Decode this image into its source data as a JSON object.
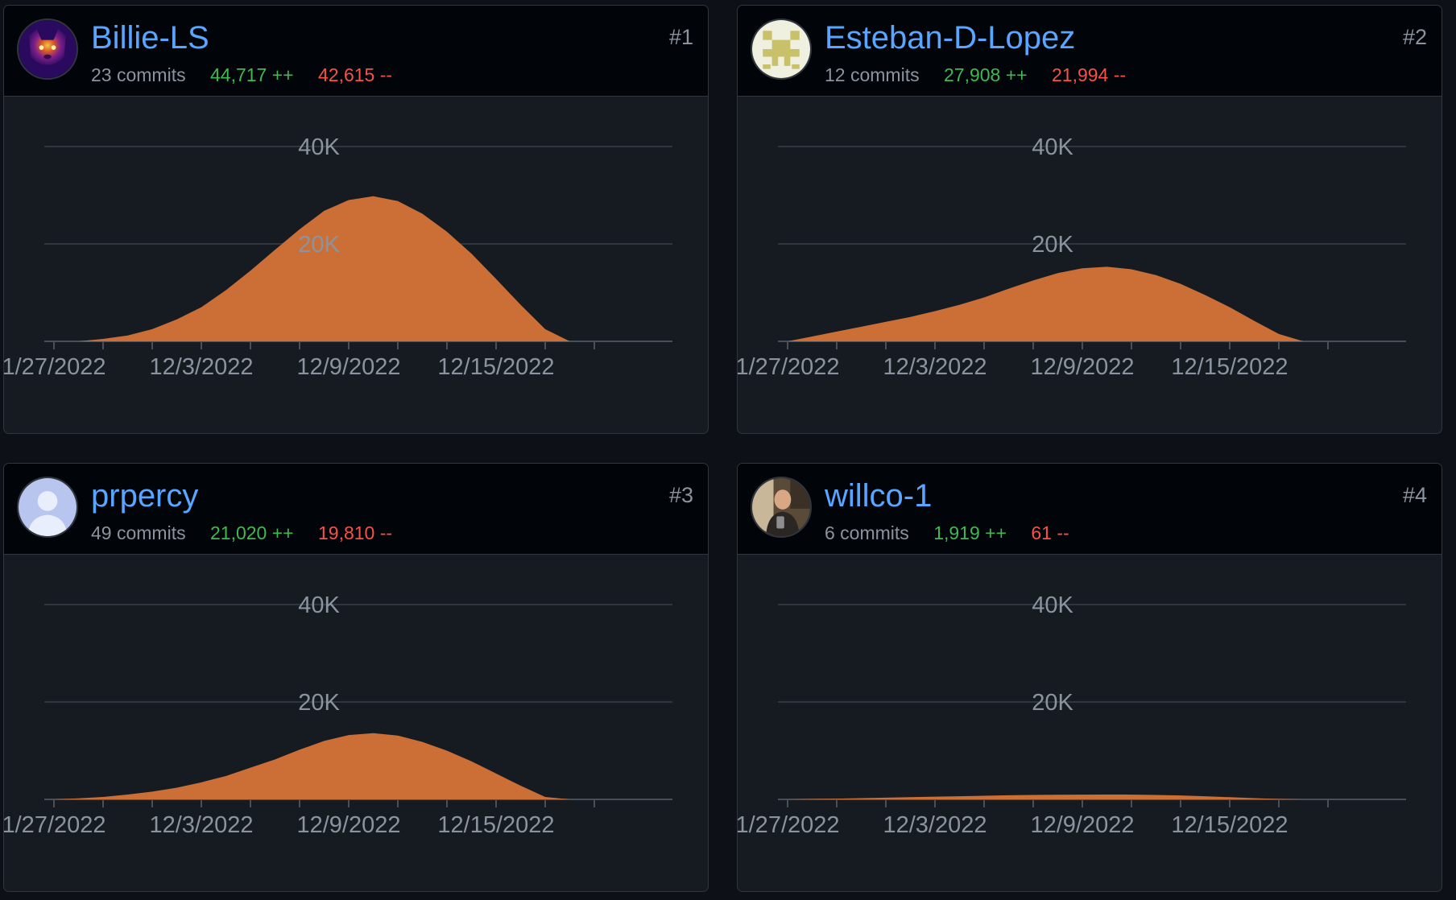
{
  "colors": {
    "area": "#cc6f37",
    "grid": "#30363d",
    "axis": "#484f58",
    "label": "#8b949e"
  },
  "cards": [
    {
      "rank": "#1",
      "username": "Billie-LS",
      "commits": "23 commits",
      "additions": "44,717 ++",
      "deletions": "42,615 --",
      "avatar": "dog-thermal-icon"
    },
    {
      "rank": "#2",
      "username": "Esteban-D-Lopez",
      "commits": "12 commits",
      "additions": "27,908 ++",
      "deletions": "21,994 --",
      "avatar": "identicon-icon"
    },
    {
      "rank": "#3",
      "username": "prpercy",
      "commits": "49 commits",
      "additions": "21,020 ++",
      "deletions": "19,810 --",
      "avatar": "default-user-icon"
    },
    {
      "rank": "#4",
      "username": "willco-1",
      "commits": "6 commits",
      "additions": "1,919 ++",
      "deletions": "61 --",
      "avatar": "user-photo-icon"
    }
  ],
  "chart_data": [
    {
      "type": "area",
      "x": [
        "11/27/2022",
        "11/28/2022",
        "11/29/2022",
        "11/30/2022",
        "12/1/2022",
        "12/2/2022",
        "12/3/2022",
        "12/4/2022",
        "12/5/2022",
        "12/6/2022",
        "12/7/2022",
        "12/8/2022",
        "12/9/2022",
        "12/10/2022",
        "12/11/2022",
        "12/12/2022",
        "12/13/2022",
        "12/14/2022",
        "12/15/2022",
        "12/16/2022",
        "12/17/2022",
        "12/18/2022",
        "12/19/2022",
        "12/20/2022"
      ],
      "xticklabels": [
        "1/27/2022",
        "12/3/2022",
        "12/9/2022",
        "12/15/2022"
      ],
      "yticklabels": [
        "20K",
        "40K"
      ],
      "ylim": [
        0,
        40000
      ],
      "values": [
        0,
        0,
        500,
        1200,
        2500,
        4500,
        7000,
        10500,
        14500,
        18800,
        23000,
        26800,
        29000,
        29800,
        28800,
        26200,
        22500,
        18000,
        12800,
        7500,
        2500,
        0,
        0,
        0
      ]
    },
    {
      "type": "area",
      "x": [
        "11/27/2022",
        "11/28/2022",
        "11/29/2022",
        "11/30/2022",
        "12/1/2022",
        "12/2/2022",
        "12/3/2022",
        "12/4/2022",
        "12/5/2022",
        "12/6/2022",
        "12/7/2022",
        "12/8/2022",
        "12/9/2022",
        "12/10/2022",
        "12/11/2022",
        "12/12/2022",
        "12/13/2022",
        "12/14/2022",
        "12/15/2022",
        "12/16/2022",
        "12/17/2022",
        "12/18/2022",
        "12/19/2022",
        "12/20/2022"
      ],
      "xticklabels": [
        "1/27/2022",
        "12/3/2022",
        "12/9/2022",
        "12/15/2022"
      ],
      "yticklabels": [
        "20K",
        "40K"
      ],
      "ylim": [
        0,
        40000
      ],
      "values": [
        0,
        1000,
        2000,
        3000,
        4000,
        5000,
        6200,
        7500,
        9000,
        10800,
        12500,
        14000,
        15000,
        15300,
        14800,
        13600,
        11800,
        9500,
        7000,
        4200,
        1500,
        0,
        0,
        0
      ]
    },
    {
      "type": "area",
      "x": [
        "11/27/2022",
        "11/28/2022",
        "11/29/2022",
        "11/30/2022",
        "12/1/2022",
        "12/2/2022",
        "12/3/2022",
        "12/4/2022",
        "12/5/2022",
        "12/6/2022",
        "12/7/2022",
        "12/8/2022",
        "12/9/2022",
        "12/10/2022",
        "12/11/2022",
        "12/12/2022",
        "12/13/2022",
        "12/14/2022",
        "12/15/2022",
        "12/16/2022",
        "12/17/2022",
        "12/18/2022",
        "12/19/2022",
        "12/20/2022"
      ],
      "xticklabels": [
        "1/27/2022",
        "12/3/2022",
        "12/9/2022",
        "12/15/2022"
      ],
      "yticklabels": [
        "20K",
        "40K"
      ],
      "ylim": [
        0,
        40000
      ],
      "values": [
        0,
        200,
        500,
        1000,
        1600,
        2400,
        3500,
        4800,
        6500,
        8200,
        10200,
        12000,
        13200,
        13600,
        13100,
        11800,
        10000,
        7800,
        5300,
        2800,
        500,
        0,
        0,
        0
      ]
    },
    {
      "type": "area",
      "x": [
        "11/27/2022",
        "11/28/2022",
        "11/29/2022",
        "11/30/2022",
        "12/1/2022",
        "12/2/2022",
        "12/3/2022",
        "12/4/2022",
        "12/5/2022",
        "12/6/2022",
        "12/7/2022",
        "12/8/2022",
        "12/9/2022",
        "12/10/2022",
        "12/11/2022",
        "12/12/2022",
        "12/13/2022",
        "12/14/2022",
        "12/15/2022",
        "12/16/2022",
        "12/17/2022",
        "12/18/2022",
        "12/19/2022",
        "12/20/2022"
      ],
      "xticklabels": [
        "1/27/2022",
        "12/3/2022",
        "12/9/2022",
        "12/15/2022"
      ],
      "yticklabels": [
        "20K",
        "40K"
      ],
      "ylim": [
        0,
        40000
      ],
      "values": [
        0,
        80,
        150,
        250,
        350,
        450,
        550,
        650,
        750,
        850,
        900,
        950,
        980,
        1000,
        980,
        900,
        800,
        650,
        450,
        250,
        80,
        0,
        0,
        0
      ]
    }
  ]
}
